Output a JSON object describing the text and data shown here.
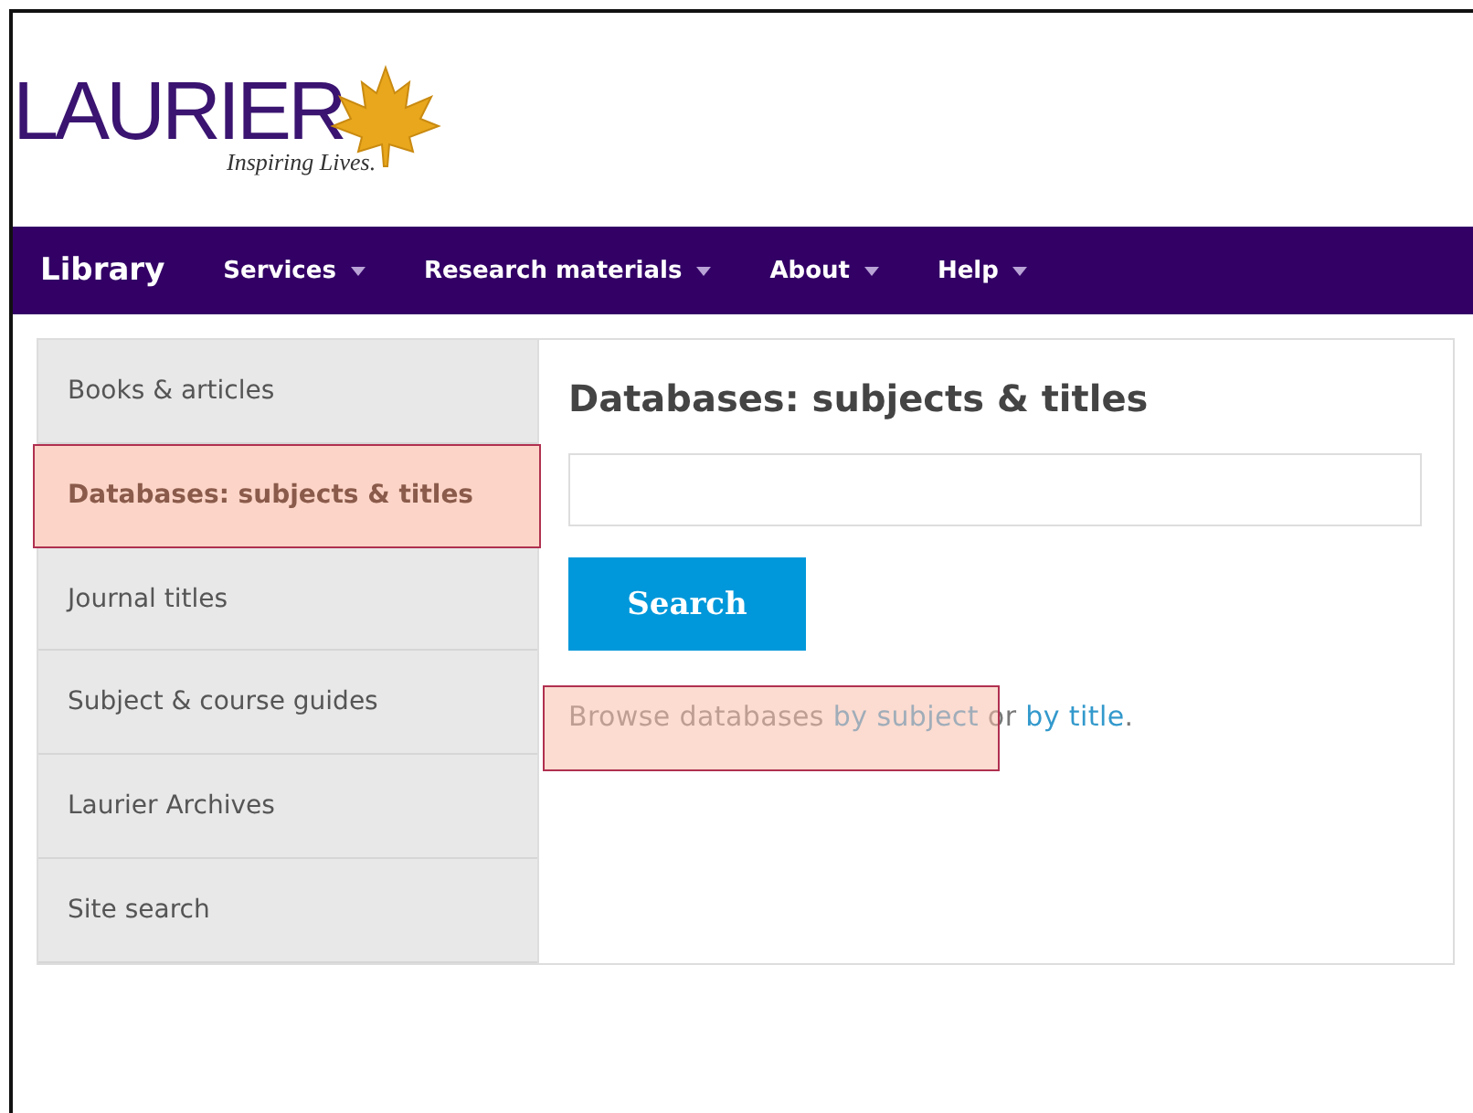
{
  "logo": {
    "wordmark": "LAURIER",
    "tagline": "Inspiring Lives."
  },
  "nav": {
    "title": "Library",
    "items": [
      {
        "label": "Services",
        "has_menu": true
      },
      {
        "label": "Research materials",
        "has_menu": true
      },
      {
        "label": "About",
        "has_menu": true
      },
      {
        "label": "Help",
        "has_menu": true
      }
    ]
  },
  "sidebar": {
    "items": [
      {
        "label": "Books & articles",
        "selected": false,
        "highlighted": false
      },
      {
        "label": "Databases: subjects & titles",
        "selected": true,
        "highlighted": true
      },
      {
        "label": "Journal titles",
        "selected": false,
        "highlighted": false
      },
      {
        "label": "Subject & course guides",
        "selected": false,
        "highlighted": false
      },
      {
        "label": "Laurier Archives",
        "selected": false,
        "highlighted": false
      },
      {
        "label": "Site search",
        "selected": false,
        "highlighted": false
      }
    ]
  },
  "main": {
    "heading": "Databases: subjects & titles",
    "search_button": "Search",
    "browse": {
      "highlighted": true,
      "parts": [
        {
          "kind": "text",
          "text": "Browse databases "
        },
        {
          "kind": "link",
          "text": "by subject"
        },
        {
          "kind": "text",
          "text": " or "
        },
        {
          "kind": "link",
          "text": "by title"
        },
        {
          "kind": "text",
          "text": "."
        }
      ]
    }
  }
}
